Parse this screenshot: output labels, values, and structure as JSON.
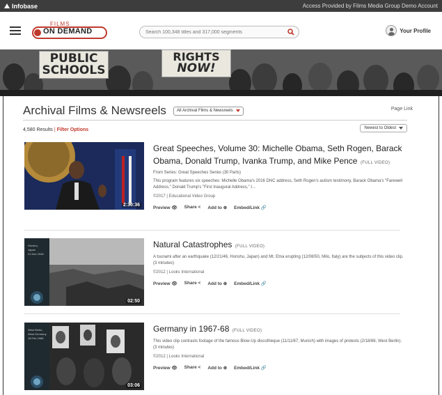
{
  "topbar": {
    "brand": "Infobase",
    "access_text": "Access Provided by Films Media Group Demo Account"
  },
  "header": {
    "logo_top": "FILMS",
    "logo_main": "ON DEMAND",
    "search_placeholder": "Search 100,348 titles and 317,000 segments",
    "profile_label": "Your Profile"
  },
  "banner": {
    "sign1_line1": "PUBLIC",
    "sign1_line2": "SCHOOLS",
    "sign2_line1": "RIGHTS",
    "sign2_line2": "NOW!"
  },
  "page": {
    "title": "Archival Films & Newsreels",
    "collection_select": "All Archival Films & Newsreels",
    "page_link": "Page Link",
    "results_count": "4,580 Results",
    "filter_options": "Filter Options",
    "sort_select": "Newest to Oldest"
  },
  "results": [
    {
      "title": "Great Speeches, Volume 30: Michelle Obama, Seth Rogen, Barack Obama, Donald Trump, Ivanka Trump, and Mike Pence",
      "tag": "(FULL VIDEO)",
      "series": "From Series: Great Speeches Series (30 Parts)",
      "description": "This program features six speeches: Michelle Obama's 2016 DNC address, Seth Rogen's autism testimony, Barack Obama's \"Farewell Address,\" Donald Trump's \"First Inaugural Address,\" I...",
      "meta": "©2017 | Educational Video Group",
      "duration": "2:30:36"
    },
    {
      "title": "Natural Catastrophes",
      "tag": "(FULL VIDEO)",
      "description": "A tsunami after an earthquake (12/21/46, Honshu, Japan) and Mt. Etna erupting (12/08/50, Milo, Italy) are the subjects of this video clip. (3 minutes)",
      "meta": "©2012 | Looks International",
      "duration": "02:50",
      "thumb_text": [
        "Honshu,",
        "Japan",
        "21 Dec 1946"
      ]
    },
    {
      "title": "Germany in 1967-68",
      "tag": "(FULL VIDEO)",
      "description": "This video clip contrasts footage of the famous Blow-Up discothèque (11/11/67, Munich) with images of protests (2/18/68, West Berlin). (3 minutes)",
      "meta": "©2012 | Looks International",
      "duration": "03:06",
      "thumb_text": [
        "West Berlin,",
        "West Germany",
        "18 Feb 1968"
      ]
    }
  ],
  "actions": {
    "preview": "Preview 👁",
    "share": "Share <",
    "add_to": "Add to ⊕",
    "embed": "Embed/Link 🔗"
  }
}
